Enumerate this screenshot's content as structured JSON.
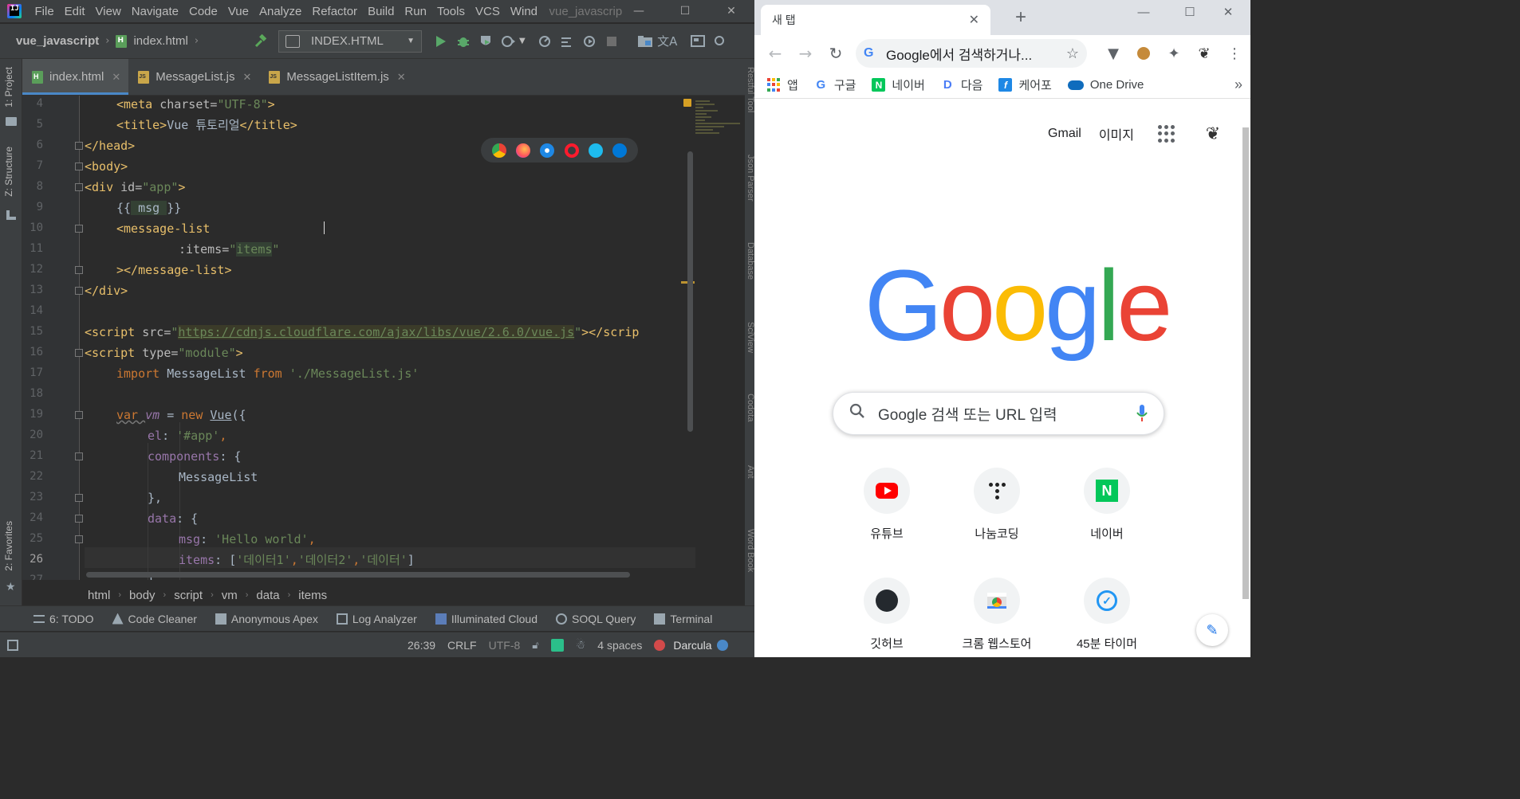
{
  "ide": {
    "logo": "IJ",
    "menu": [
      "File",
      "Edit",
      "View",
      "Navigate",
      "Code",
      "Vue",
      "Analyze",
      "Refactor",
      "Build",
      "Run",
      "Tools",
      "VCS",
      "Wind"
    ],
    "window_title": "vue_javascrip",
    "window_buttons": {
      "minimize": "—",
      "maximize": "☐",
      "close": "✕"
    },
    "navbar": {
      "project": "vue_javascript",
      "file": "index.html",
      "run_config": "INDEX.HTML"
    },
    "left_tool_tabs": [
      "1: Project",
      "Z: Structure",
      "2: Favorites"
    ],
    "right_tool_tabs": [
      "Restful Tool",
      "Json Parser",
      "Database",
      "SciView",
      "Codota",
      "Ant",
      "Word Book"
    ],
    "tabs": [
      {
        "label": "index.html",
        "type": "html",
        "active": true
      },
      {
        "label": "MessageList.js",
        "type": "js",
        "active": false
      },
      {
        "label": "MessageListItem.js",
        "type": "js",
        "active": false
      }
    ],
    "code_lines": [
      {
        "n": "4"
      },
      {
        "n": "5"
      },
      {
        "n": "6"
      },
      {
        "n": "7"
      },
      {
        "n": "8"
      },
      {
        "n": "9"
      },
      {
        "n": "10"
      },
      {
        "n": "11"
      },
      {
        "n": "12"
      },
      {
        "n": "13"
      },
      {
        "n": "14"
      },
      {
        "n": "15"
      },
      {
        "n": "16"
      },
      {
        "n": "17"
      },
      {
        "n": "18"
      },
      {
        "n": "19"
      },
      {
        "n": "20"
      },
      {
        "n": "21"
      },
      {
        "n": "22"
      },
      {
        "n": "23"
      },
      {
        "n": "24"
      },
      {
        "n": "25"
      },
      {
        "n": "26"
      },
      {
        "n": "27"
      }
    ],
    "code": {
      "l4": [
        "<meta ",
        "charset",
        "=",
        "\"UTF-8\"",
        ">"
      ],
      "l5": [
        "<title>",
        "Vue 튜토리얼",
        "</title>"
      ],
      "l6": "</head>",
      "l7": "<body>",
      "l8": [
        "<div ",
        "id",
        "=",
        "\"app\"",
        ">"
      ],
      "l9": [
        "{{",
        " msg ",
        "}}"
      ],
      "l10": "<message-list",
      "l11": [
        ":items",
        "=",
        "\"",
        "items",
        "\""
      ],
      "l12": "></message-list>",
      "l13": "</div>",
      "l15": [
        "<script ",
        "src",
        "=",
        "\"",
        "https://cdnjs.cloudflare.com/ajax/libs/vue/2.6.0/vue.js",
        "\"",
        "></scrip"
      ],
      "l16": [
        "<script ",
        "type",
        "=",
        "\"module\"",
        ">"
      ],
      "l17": [
        "import ",
        "MessageList ",
        "from ",
        "'./MessageList.js'"
      ],
      "l19": [
        "var ",
        "vm",
        " = ",
        "new ",
        "Vue",
        "({"
      ],
      "l20": [
        "el",
        ": ",
        "'#app'",
        ","
      ],
      "l21": [
        "components",
        ": {"
      ],
      "l22": "MessageList",
      "l23": "},",
      "l24": [
        "data",
        ": {"
      ],
      "l25": [
        "msg",
        ": ",
        "'Hello world'",
        ","
      ],
      "l26": [
        "items",
        ": [",
        "'데이터1'",
        ",",
        "'데이터2'",
        ",",
        "'데이터'",
        "]"
      ],
      "l27": "}"
    },
    "breadcrumbs": [
      "html",
      "body",
      "script",
      "vm",
      "data",
      "items"
    ],
    "tool_windows": [
      "6: TODO",
      "Code Cleaner",
      "Anonymous Apex",
      "Log Analyzer",
      "Illuminated Cloud",
      "SOQL Query",
      "Terminal"
    ],
    "status": {
      "position": "26:39",
      "line_sep": "CRLF",
      "encoding": "UTF-8",
      "indent": "4 spaces",
      "theme": "Darcula"
    }
  },
  "chrome": {
    "tab_title": "새 탭",
    "new_tab": "+",
    "window_buttons": {
      "minimize": "—",
      "maximize": "☐",
      "close": "✕"
    },
    "omnibox_text": "Google에서 검색하거나...",
    "bookmarks": [
      {
        "label": "앱",
        "icon": "apps-grid-icon"
      },
      {
        "label": "구글",
        "icon": "google-icon"
      },
      {
        "label": "네이버",
        "icon": "naver-icon"
      },
      {
        "label": "다음",
        "icon": "daum-icon"
      },
      {
        "label": "케어포",
        "icon": "carefor-icon"
      },
      {
        "label": "One Drive",
        "icon": "onedrive-icon"
      }
    ],
    "bookmarks_more": "»",
    "top_links": [
      "Gmail",
      "이미지"
    ],
    "logo_letters": [
      "G",
      "o",
      "o",
      "g",
      "l",
      "e"
    ],
    "logo_colors": [
      "#4285f4",
      "#ea4335",
      "#fbbc05",
      "#4285f4",
      "#34a853",
      "#ea4335"
    ],
    "search_placeholder": "Google 검색 또는 URL 입력",
    "shortcuts": [
      {
        "label": "유튜브",
        "icon": "youtube-icon"
      },
      {
        "label": "나눔코딩",
        "icon": "nanumcoding-icon"
      },
      {
        "label": "네이버",
        "icon": "naver-icon"
      },
      {
        "label": "깃허브",
        "icon": "github-icon"
      },
      {
        "label": "크롬 웹스토어",
        "icon": "chrome-webstore-icon"
      },
      {
        "label": "45분 타이머",
        "icon": "timer-icon"
      }
    ]
  }
}
